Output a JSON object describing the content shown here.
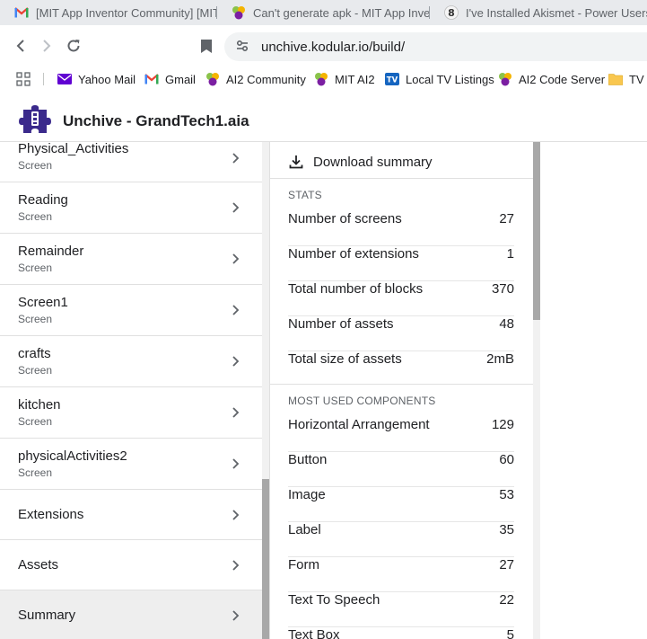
{
  "browser": {
    "tabs": [
      {
        "title": "[MIT App Inventor Community] [MIT",
        "favicon": "gmail-icon"
      },
      {
        "title": "Can't generate apk - MIT App Inven",
        "favicon": "mit-ai2-icon"
      },
      {
        "title": "I've Installed Akismet - Power Users",
        "favicon": "discourse-8-icon"
      }
    ],
    "url": "unchive.kodular.io/build/",
    "bookmarks": [
      {
        "label": "Yahoo Mail",
        "icon": "yahoo-mail-icon"
      },
      {
        "label": "Gmail",
        "icon": "gmail-icon"
      },
      {
        "label": "AI2 Community",
        "icon": "mit-ai2-icon"
      },
      {
        "label": "MIT AI2",
        "icon": "mit-ai2-icon"
      },
      {
        "label": "Local TV Listings",
        "icon": "tv-icon"
      },
      {
        "label": "AI2 Code Server",
        "icon": "mit-ai2-icon"
      },
      {
        "label": "TV",
        "icon": "folder-icon"
      }
    ]
  },
  "app": {
    "title": "Unchive - GrandTech1.aia"
  },
  "sidebar": {
    "screens": [
      {
        "name": "Physical_Activities",
        "sub": "Screen"
      },
      {
        "name": "Reading",
        "sub": "Screen"
      },
      {
        "name": "Remainder",
        "sub": "Screen"
      },
      {
        "name": "Screen1",
        "sub": "Screen"
      },
      {
        "name": "crafts",
        "sub": "Screen"
      },
      {
        "name": "kitchen",
        "sub": "Screen"
      },
      {
        "name": "physicalActivities2",
        "sub": "Screen"
      }
    ],
    "sections": [
      {
        "name": "Extensions"
      },
      {
        "name": "Assets"
      },
      {
        "name": "Summary"
      }
    ]
  },
  "summary": {
    "download_label": "Download summary",
    "stats_heading": "STATS",
    "stats": [
      {
        "label": "Number of screens",
        "value": "27"
      },
      {
        "label": "Number of extensions",
        "value": "1"
      },
      {
        "label": "Total number of blocks",
        "value": "370"
      },
      {
        "label": "Number of assets",
        "value": "48"
      },
      {
        "label": "Total size of assets",
        "value": "2mB"
      }
    ],
    "components_heading": "MOST USED COMPONENTS",
    "components": [
      {
        "label": "Horizontal Arrangement",
        "value": "129"
      },
      {
        "label": "Button",
        "value": "60"
      },
      {
        "label": "Image",
        "value": "53"
      },
      {
        "label": "Label",
        "value": "35"
      },
      {
        "label": "Form",
        "value": "27"
      },
      {
        "label": "Text To Speech",
        "value": "22"
      },
      {
        "label": "Text Box",
        "value": "5"
      }
    ]
  },
  "colors": {
    "tabstrip_bg": "#e8eaed",
    "omnibox_bg": "#f1f3f4",
    "active_item_bg": "#eeeeee",
    "logo_purple": "#3b2a8c"
  }
}
